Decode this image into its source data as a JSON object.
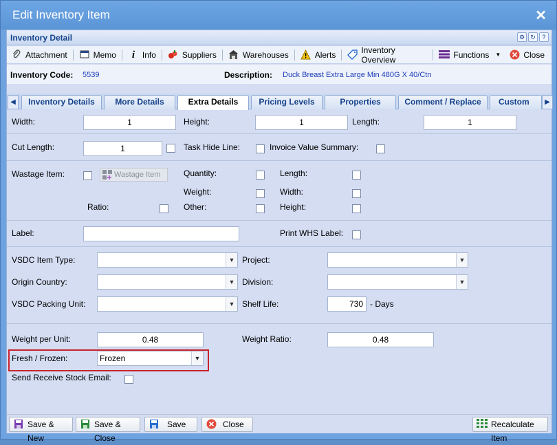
{
  "window": {
    "title": "Edit Inventory Item"
  },
  "panel": {
    "title": "Inventory Detail"
  },
  "toolbar": {
    "attachment": "Attachment",
    "memo": "Memo",
    "info": "Info",
    "suppliers": "Suppliers",
    "warehouses": "Warehouses",
    "alerts": "Alerts",
    "inventory_overview": "Inventory Overview",
    "functions": "Functions",
    "close": "Close"
  },
  "header": {
    "code_label": "Inventory Code:",
    "code_value": "5539",
    "desc_label": "Description:",
    "desc_value": "Duck Breast Extra Large Min 480G X 40/Ctn"
  },
  "tabs": [
    "Inventory Details",
    "More Details",
    "Extra Details",
    "Pricing Levels",
    "Properties",
    "Comment / Replace",
    "Custom Fie"
  ],
  "active_tab": "Extra Details",
  "dimensions": {
    "width_label": "Width:",
    "width_value": "1",
    "height_label": "Height:",
    "height_value": "1",
    "length_label": "Length:",
    "length_value": "1"
  },
  "cut": {
    "cut_length_label": "Cut Length:",
    "cut_length_value": "1",
    "task_hide_label": "Task Hide Line:",
    "invoice_value_label": "Invoice Value Summary:"
  },
  "wastage": {
    "wastage_item_label": "Wastage Item:",
    "wastage_button": "Wastage Item",
    "quantity_label": "Quantity:",
    "weight_label": "Weight:",
    "other_label": "Other:",
    "ratio_label": "Ratio:",
    "length_label": "Length:",
    "width_label": "Width:",
    "height_label": "Height:"
  },
  "label_section": {
    "label_label": "Label:",
    "label_value": "",
    "print_whs_label": "Print WHS Label:"
  },
  "vsdc": {
    "item_type_label": "VSDC Item Type:",
    "item_type_value": "",
    "project_label": "Project:",
    "project_value": "",
    "origin_label": "Origin Country:",
    "origin_value": "",
    "division_label": "Division:",
    "division_value": "",
    "packing_label": "VSDC Packing Unit:",
    "packing_value": "",
    "shelf_life_label": "Shelf Life:",
    "shelf_life_value": "730",
    "shelf_life_unit": "- Days"
  },
  "weight": {
    "per_unit_label": "Weight per Unit:",
    "per_unit_value": "0.48",
    "ratio_label": "Weight Ratio:",
    "ratio_value": "0.48",
    "fresh_frozen_label": "Fresh / Frozen:",
    "fresh_frozen_value": "Frozen",
    "send_email_label": "Send Receive Stock Email:"
  },
  "footer": {
    "save_new": "Save & New",
    "save_close": "Save & Close",
    "save": "Save",
    "close": "Close",
    "recalculate": "Recalculate Item"
  },
  "colors": {
    "titlebar": "#5b95d6",
    "panel": "#d4ddf2",
    "highlight": "#c9222c",
    "link_value": "#1c3bb8"
  }
}
